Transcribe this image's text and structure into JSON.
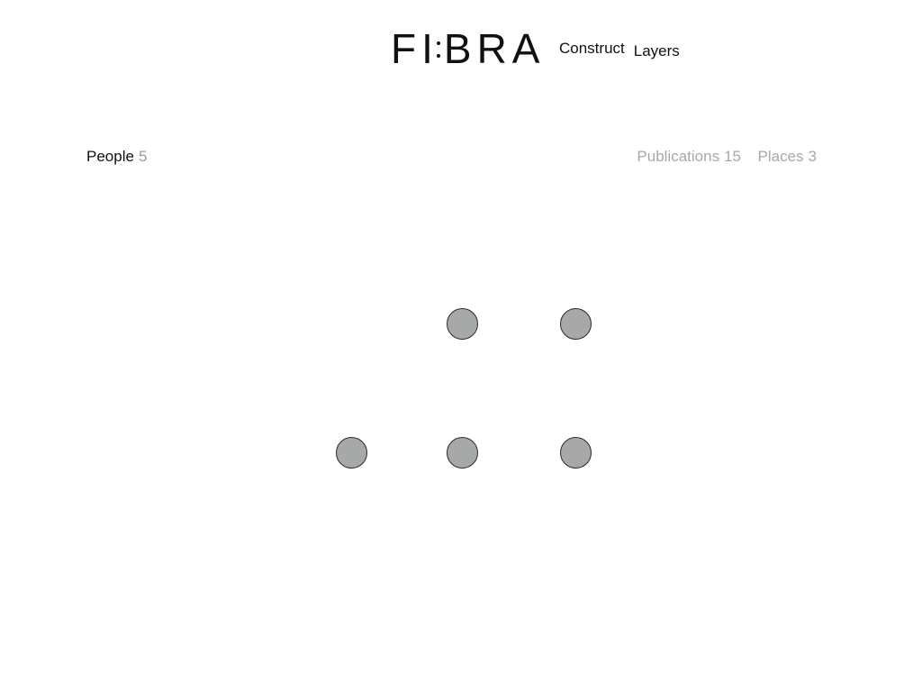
{
  "header": {
    "logo": {
      "part1": "FI",
      "part2": "BRA"
    },
    "nav": [
      {
        "label": "Construct"
      },
      {
        "label": "Layers"
      }
    ]
  },
  "tabs": {
    "people": {
      "label": "People",
      "count": "5",
      "active": true
    },
    "publications": {
      "label": "Publications",
      "count": "15",
      "active": false
    },
    "places": {
      "label": "Places",
      "count": "3",
      "active": false
    }
  },
  "nodes": {
    "count": 5,
    "fill_color": "#a6a9a7",
    "stroke_color": "#2a2a2a"
  },
  "colors": {
    "text_primary": "#111111",
    "text_muted": "#a8a8a8",
    "background": "#ffffff"
  }
}
